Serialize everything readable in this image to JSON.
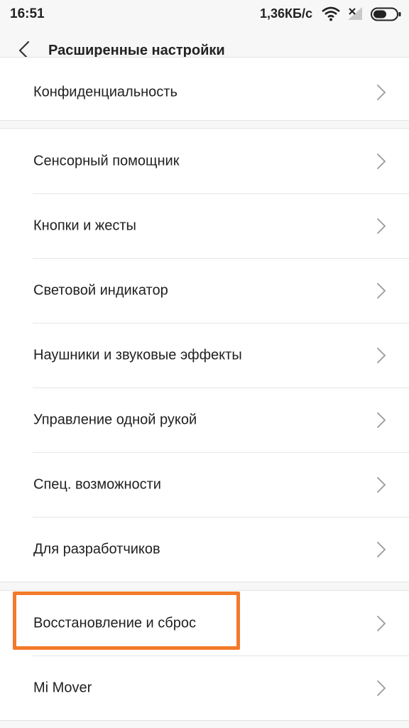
{
  "status_bar": {
    "time": "16:51",
    "network_speed": "1,36КБ/с",
    "icons": [
      "wifi-icon",
      "signal-icon",
      "battery-icon"
    ]
  },
  "app_bar": {
    "title": "Расширенные настройки",
    "back_icon": "chevron-left-icon"
  },
  "sections": [
    {
      "items": [
        {
          "label": "Конфиденциальность"
        }
      ]
    },
    {
      "items": [
        {
          "label": "Сенсорный помощник"
        },
        {
          "label": "Кнопки и жесты"
        },
        {
          "label": "Световой индикатор"
        },
        {
          "label": "Наушники и звуковые эффекты"
        },
        {
          "label": "Управление одной рукой"
        },
        {
          "label": "Спец. возможности"
        },
        {
          "label": "Для разработчиков"
        }
      ]
    },
    {
      "items": [
        {
          "label": "Восстановление и сброс"
        },
        {
          "label": "Mi Mover"
        }
      ]
    }
  ],
  "colors": {
    "highlight": "#f37a2a",
    "background": "#f7f7f7",
    "card": "#ffffff"
  }
}
